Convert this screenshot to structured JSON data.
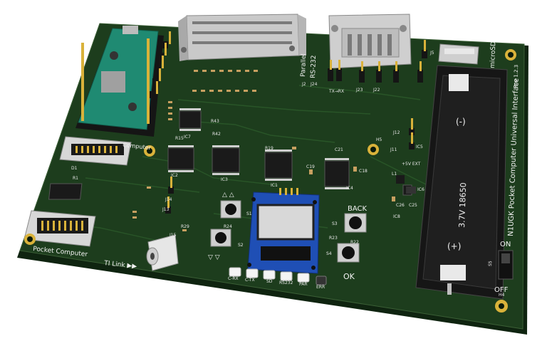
{
  "board": {
    "title": "N1UGK Pocket Computer Universal Interface",
    "revision": "Rev 1.2.3",
    "colors": {
      "pcb": "#1d3d1d",
      "pcb_edge": "#0f2410",
      "silkscreen": "#f2f2f2",
      "gold": "#d9b23a",
      "header_black": "#151515",
      "oled_blue": "#1f4fb5",
      "pico_teal": "#1f8a72"
    }
  },
  "connectors": {
    "parallel": "Parallel",
    "rs232": "RS-232",
    "microsd": "microSD",
    "pocket_computer": "Pocket Computer",
    "ti_link": "TI Link ▶▶",
    "computer": "Computer"
  },
  "battery": {
    "label": "3.7V 18650",
    "minus": "(-)",
    "plus": "(+)"
  },
  "buttons": {
    "back": "BACK",
    "ok": "OK",
    "up_arrows": "△ △",
    "down_arrows": "▽ ▽"
  },
  "power_switch": {
    "on": "ON",
    "off": "OFF",
    "ref": "S5"
  },
  "leds": [
    "C-RX",
    "C-TX",
    "SD",
    "RS232",
    "PAR",
    "ERR"
  ],
  "refs": {
    "ic1": "IC1",
    "ic2": "IC2",
    "ic3": "IC3",
    "ic4": "IC4",
    "ic5": "IC5",
    "ic6": "IC6",
    "ic7": "IC7",
    "ic8": "IC8",
    "s1": "S1",
    "s2": "S2",
    "s3": "S3",
    "s4": "S4",
    "j2": "J2",
    "j5": "J5",
    "j11": "J11",
    "j12": "J12",
    "j13": "J13",
    "j14": "J14",
    "j15": "J15",
    "j22": "J22",
    "j23": "J23",
    "j24": "J24",
    "h4": "H4",
    "h5": "H5",
    "r19": "R19",
    "r22": "R22",
    "r23": "R23",
    "r24": "R24",
    "r29": "R29",
    "r15": "R15",
    "r43": "R43",
    "r42": "R42",
    "c19": "C19",
    "c18": "C18",
    "c21": "C21",
    "c25": "C25",
    "c26": "C26",
    "l1": "L1",
    "d1": "D1",
    "r1": "R1",
    "ext": "+5V EXT",
    "txrx": "TX→RX"
  }
}
